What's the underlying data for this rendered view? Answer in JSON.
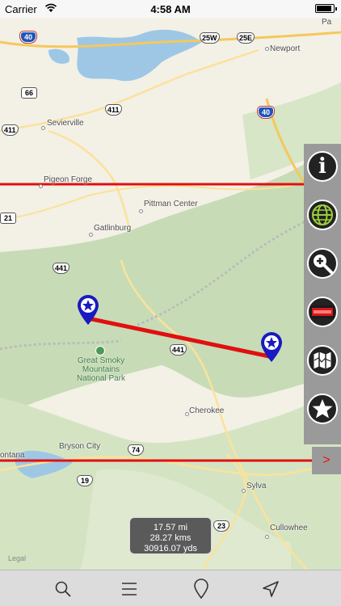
{
  "status": {
    "carrier": "Carrier",
    "time": "4:58 AM"
  },
  "map": {
    "places": [
      "Newport",
      "Sevierville",
      "Pigeon Forge",
      "Pittman Center",
      "Gatlinburg",
      "Cherokee",
      "Bryson City",
      "Sylva",
      "Cullowhee",
      "Pa",
      "ontana"
    ],
    "park": {
      "line1": "Great Smoky",
      "line2": "Mountains",
      "line3": "National Park"
    },
    "shields": {
      "i40_top": "40",
      "r66": "66",
      "r411a": "411",
      "r411b": "411",
      "r21": "21",
      "r25w": "25W",
      "r25e": "25E",
      "i40_right": "40",
      "r441a": "441",
      "r441b": "441",
      "r74": "74",
      "r19": "19",
      "r23": "23"
    },
    "legal": "Legal"
  },
  "distance": {
    "miles": "17.57 mi",
    "kms": "28.27 kms",
    "yds": "30916.07 yds"
  },
  "side_panel": {
    "buttons": [
      "info",
      "globe",
      "zoom",
      "logo",
      "map",
      "favorite"
    ],
    "tab_arrow": ">"
  },
  "toolbar": {
    "items": [
      "search",
      "menu",
      "location-pin",
      "navigate"
    ]
  }
}
